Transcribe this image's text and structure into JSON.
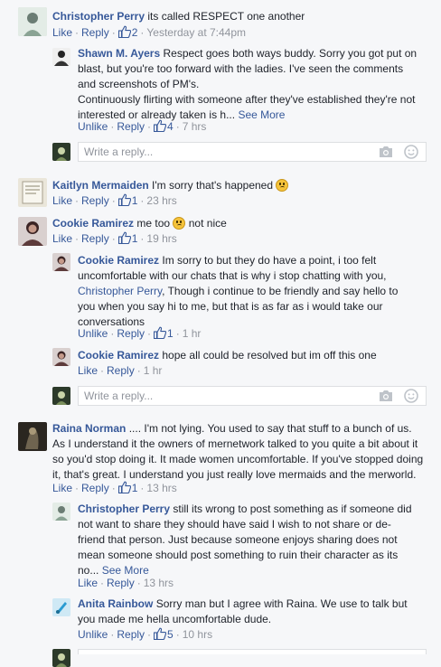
{
  "ui": {
    "like": "Like",
    "unlike": "Unlike",
    "reply": "Reply",
    "see_more": "See More",
    "write_reply_placeholder": "Write a reply...",
    "dot": "·",
    "ellipsis": "..."
  },
  "comments": {
    "c1": {
      "author": "Christopher Perry",
      "text": "its called RESPECT one another",
      "likes": "2",
      "time": "Yesterday at 7:44pm"
    },
    "r1": {
      "author": "Shawn M. Ayers",
      "text": "Respect goes both ways buddy. Sorry you got put on blast, but you're too forward with the ladies. I've seen the comments and screenshots of PM's.",
      "text2": "Continuously flirting with someone after they've established they're not interested or already taken is h",
      "likes": "4",
      "time": "7 hrs"
    },
    "c2": {
      "author": "Kaitlyn Mermaiden",
      "text": "I'm sorry that's happened",
      "likes": "1",
      "time": "23 hrs"
    },
    "c3": {
      "author": "Cookie Ramirez",
      "text": "me too",
      "text_after": "not nice",
      "likes": "1",
      "time": "19 hrs"
    },
    "r2": {
      "author": "Cookie Ramirez",
      "text": "Im sorry to but they do have a point, i too felt uncomfortable with our chats that is why i stop chatting with you,",
      "mention": "Christopher Perry",
      "text2": ", Though i continue to be friendly and say hello to you when you say hi to me, but that is as far as i would take our conversations",
      "likes": "1",
      "time": "1 hr"
    },
    "r3": {
      "author": "Cookie Ramirez",
      "text": "hope all could be resolved but im off this one",
      "time": "1 hr"
    },
    "c4": {
      "author": "Raina Norman",
      "text": ".... I'm not lying. You used to say that stuff to a bunch of us. As I understand it the owners of mernetwork talked to you quite a bit about it so you'd stop doing it. It made women uncomfortable. If you've stopped doing it, that's great. I understand you just really love mermaids and the merworld.",
      "likes": "1",
      "time": "13 hrs"
    },
    "r4": {
      "author": "Christopher Perry",
      "text": "still its wrong to post something as if someone did not want to share they should have said I wish to not share or de-friend that person. Just because someone enjoys sharing does not mean someone should post something to ruin their character as its no",
      "time": "13 hrs"
    },
    "r5": {
      "author": "Anita Rainbow",
      "text": "Sorry man but I agree with Raina. We use to talk but you made me hella uncomfortable dude.",
      "likes": "5",
      "time": "10 hrs"
    }
  },
  "colors": {
    "link": "#365899",
    "meta": "#90949c",
    "text": "#1d2129",
    "background": "#f6f7f9"
  },
  "icons": {
    "like": "thumbs-up-icon",
    "camera": "camera-icon",
    "sticker": "sticker-icon",
    "emoji": "frown-emoji-icon"
  }
}
